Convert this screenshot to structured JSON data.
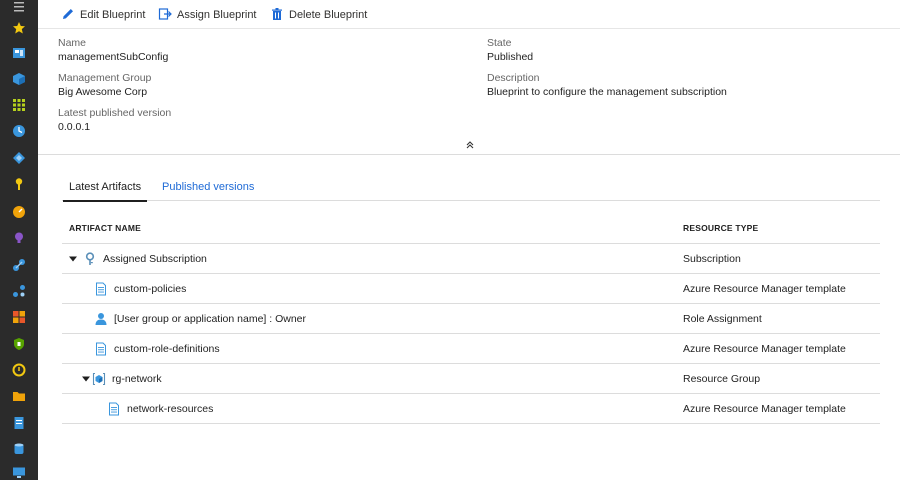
{
  "toolbar": {
    "edit_label": "Edit Blueprint",
    "assign_label": "Assign Blueprint",
    "delete_label": "Delete Blueprint",
    "icon_color": "#1e6ad6"
  },
  "essentials": {
    "name_label": "Name",
    "name_value": "managementSubConfig",
    "mg_label": "Management Group",
    "mg_value": "Big Awesome Corp",
    "version_label": "Latest published version",
    "version_value": "0.0.0.1",
    "state_label": "State",
    "state_value": "Published",
    "desc_label": "Description",
    "desc_value": "Blueprint to configure the management subscription"
  },
  "tabs": [
    {
      "label": "Latest Artifacts",
      "active": true
    },
    {
      "label": "Published versions",
      "active": false
    }
  ],
  "table": {
    "headers": {
      "name": "ARTIFACT NAME",
      "type": "RESOURCE TYPE"
    },
    "rows": [
      {
        "name": "Assigned Subscription",
        "type": "Subscription",
        "icon": "key-icon",
        "expander": true
      },
      {
        "name": "custom-policies",
        "type": "Azure Resource Manager template",
        "icon": "document-icon"
      },
      {
        "name": "[User group or application name] : Owner",
        "type": "Role Assignment",
        "icon": "user-icon"
      },
      {
        "name": "custom-role-definitions",
        "type": "Azure Resource Manager template",
        "icon": "document-icon"
      },
      {
        "name": "rg-network",
        "type": "Resource Group",
        "icon": "resource-group-icon",
        "expander": true
      },
      {
        "name": "network-resources",
        "type": "Azure Resource Manager template",
        "icon": "document-icon"
      }
    ]
  },
  "colors": {
    "rail": "#2b2b2b",
    "link": "#1e6ad6",
    "border": "#dcdcdc"
  }
}
